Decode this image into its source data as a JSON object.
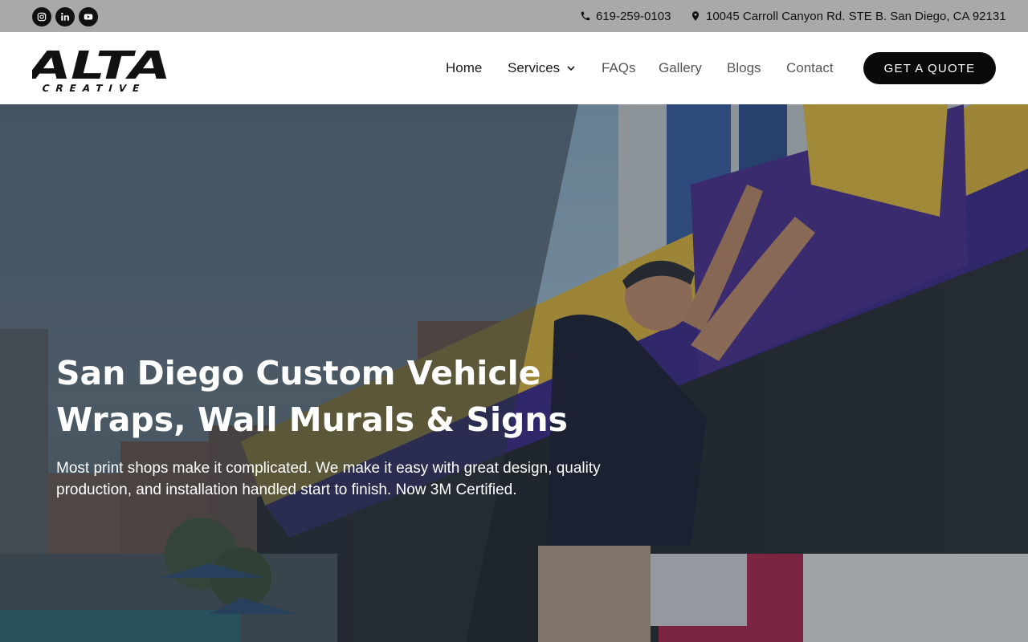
{
  "topbar": {
    "social": [
      "instagram-icon",
      "linkedin-icon",
      "youtube-icon"
    ],
    "phone": "619-259-0103",
    "address": "10045 Carroll Canyon Rd. STE B. San Diego, CA 92131"
  },
  "header": {
    "logo": {
      "word": "ALTA",
      "sub": "CREATIVE"
    },
    "nav": [
      {
        "label": "Home"
      },
      {
        "label": "Services"
      },
      {
        "label": "FAQs"
      },
      {
        "label": "Gallery"
      },
      {
        "label": "Blogs"
      },
      {
        "label": "Contact"
      }
    ],
    "cta": "GET A QUOTE"
  },
  "hero": {
    "title_line1": "San Diego Custom Vehicle",
    "title_line2": "Wraps, Wall Murals & Signs",
    "subtitle_line1": "Most print shops make it complicated. We make it easy with great design, quality",
    "subtitle_line2": "production, and installation handled start to finish. Now 3M Certified."
  },
  "colors": {
    "topbar_bg": "#a9a9a9",
    "cta_bg": "#0a0a0a",
    "banner_yellow": "#e2b83b",
    "banner_purple": "#3d2a8a"
  }
}
